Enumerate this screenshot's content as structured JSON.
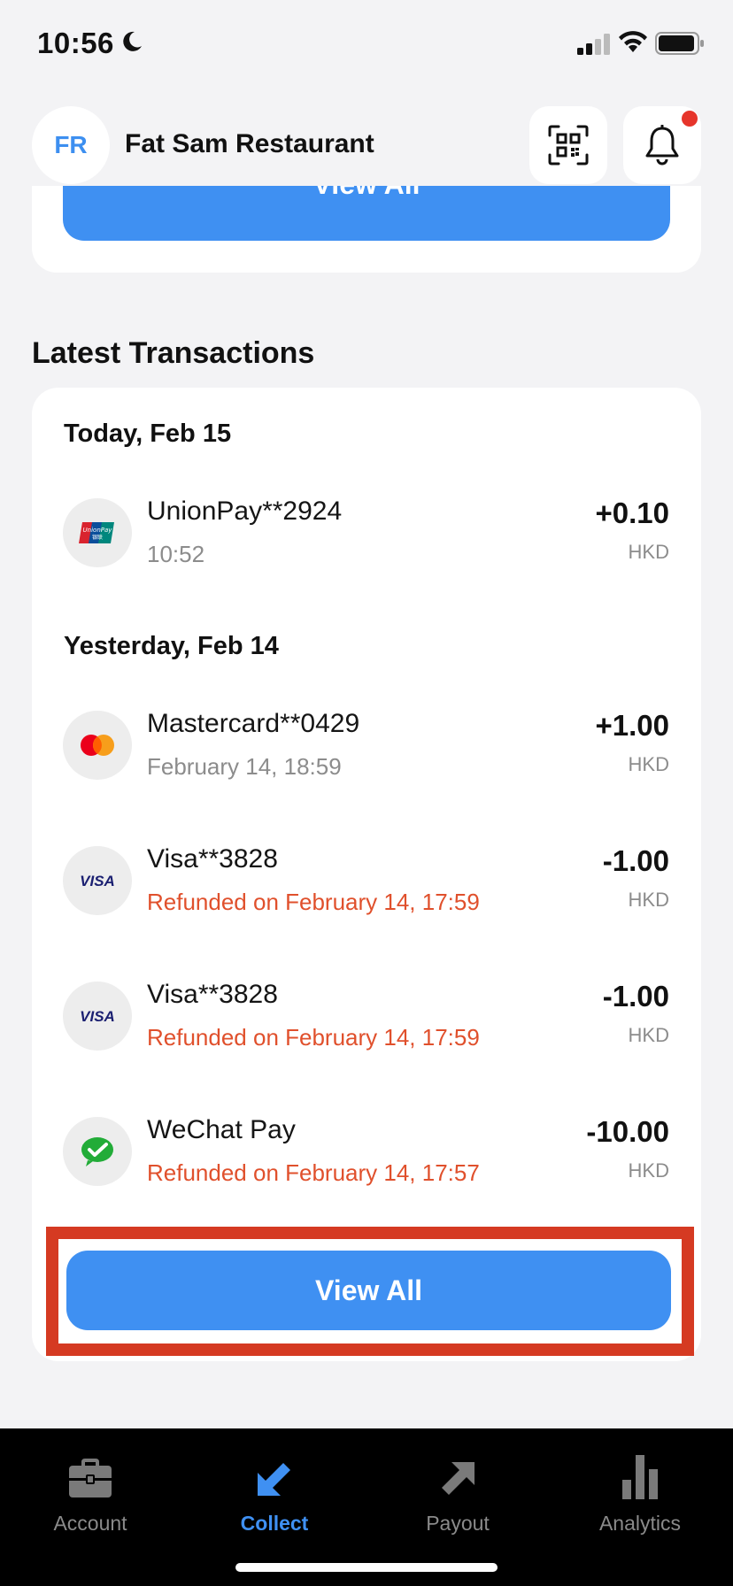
{
  "status_bar": {
    "time": "10:56"
  },
  "header": {
    "avatar_initials": "FR",
    "merchant_name": "Fat Sam Restaurant"
  },
  "top_card": {
    "button_label": "View All"
  },
  "transactions": {
    "title": "Latest Transactions",
    "groups": [
      {
        "label": "Today, Feb 15",
        "items": [
          {
            "icon": "unionpay-icon",
            "name": "UnionPay**2924",
            "detail": "10:52",
            "amount": "+0.10",
            "currency": "HKD"
          }
        ]
      },
      {
        "label": "Yesterday, Feb 14",
        "items": [
          {
            "icon": "mastercard-icon",
            "name": "Mastercard**0429",
            "detail": "February 14, 18:59",
            "amount": "+1.00",
            "currency": "HKD"
          },
          {
            "icon": "visa-icon",
            "name": "Visa**3828",
            "detail": "Refunded on February 14, 17:59",
            "amount": "-1.00",
            "currency": "HKD"
          },
          {
            "icon": "visa-icon",
            "name": "Visa**3828",
            "detail": "Refunded on February 14, 17:59",
            "amount": "-1.00",
            "currency": "HKD"
          },
          {
            "icon": "wechat-pay-icon",
            "name": "WeChat Pay",
            "detail": "Refunded on February 14, 17:57",
            "amount": "-10.00",
            "currency": "HKD"
          }
        ]
      }
    ],
    "view_all_label": "View All"
  },
  "tab_bar": {
    "tabs": [
      {
        "label": "Account",
        "icon": "briefcase-icon",
        "active": false
      },
      {
        "label": "Collect",
        "icon": "arrow-down-left-icon",
        "active": true
      },
      {
        "label": "Payout",
        "icon": "arrow-up-right-icon",
        "active": false
      },
      {
        "label": "Analytics",
        "icon": "bar-chart-icon",
        "active": false
      }
    ]
  },
  "colors": {
    "accent": "#3f90f2",
    "refund": "#e0502c",
    "highlight": "#d53a22",
    "notification": "#e6352b"
  }
}
